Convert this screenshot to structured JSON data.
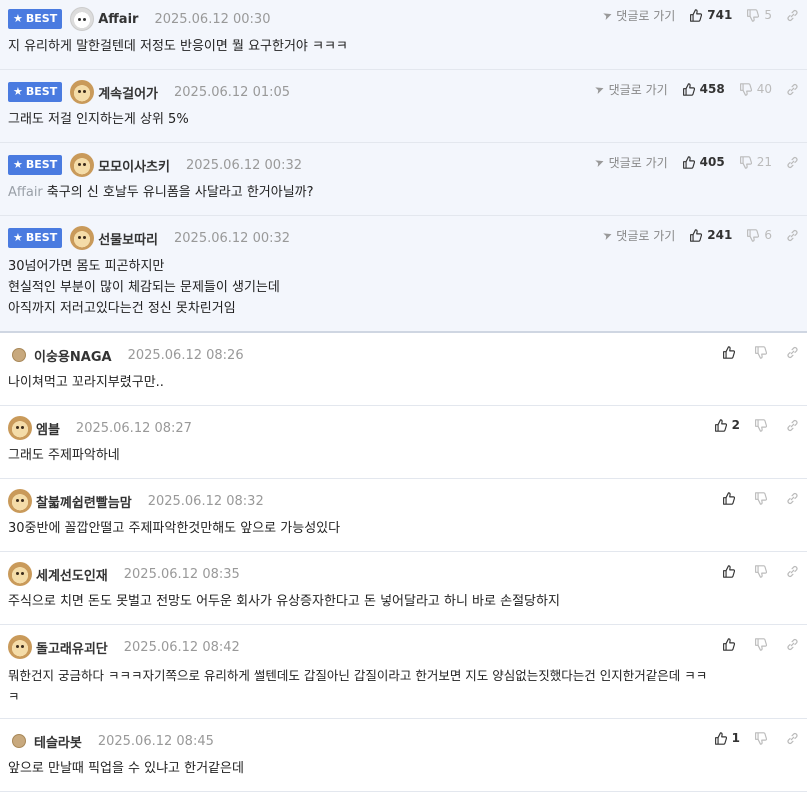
{
  "best_label": "BEST",
  "goto_label": "댓글로 가기",
  "comments": [
    {
      "author": "Affair",
      "date": "2025.06.12 00:30",
      "up": "741",
      "down": "5",
      "lines": [
        "지 유리하게 말한걸텐데 저정도 반응이면 뭘 요구한거야 ㅋㅋㅋ"
      ]
    },
    {
      "author": "계속걸어가",
      "date": "2025.06.12 01:05",
      "up": "458",
      "down": "40",
      "lines": [
        "그래도 저걸 인지하는게 상위 5%"
      ]
    },
    {
      "author": "모모이사츠키",
      "date": "2025.06.12 00:32",
      "up": "405",
      "down": "21",
      "reply_to": "Affair",
      "lines": [
        "축구의 신 호날두 유니폼을 사달라고 한거아닐까?"
      ]
    },
    {
      "author": "선물보따리",
      "date": "2025.06.12 00:32",
      "up": "241",
      "down": "6",
      "lines": [
        "30넘어가면 몸도 피곤하지만",
        "현실적인 부분이 많이 체감되는 문제들이 생기는데",
        "아직까지 저러고있다는건 정신 못차린거임"
      ]
    },
    {
      "author": "이숭용NAGA",
      "date": "2025.06.12 08:26",
      "up": "",
      "down": "",
      "lines": [
        "나이쳐먹고 꼬라지부렸구만.."
      ]
    },
    {
      "author": "엠블",
      "date": "2025.06.12 08:27",
      "up": "2",
      "down": "",
      "lines": [
        "그래도 주제파악하네"
      ]
    },
    {
      "author": "찰붋꼐쉽련빨늠맘",
      "date": "2025.06.12 08:32",
      "up": "",
      "down": "",
      "lines": [
        "30중반에 꼴깝안떨고 주제파악한것만해도 앞으로 가능성있다"
      ]
    },
    {
      "author": "세계선도인재",
      "date": "2025.06.12 08:35",
      "up": "",
      "down": "",
      "lines": [
        "주식으로 치면 돈도 못벌고 전망도 어두운 회사가 유상증자한다고 돈 넣어달라고 하니 바로 손절당하지"
      ]
    },
    {
      "author": "돌고래유괴단",
      "date": "2025.06.12 08:42",
      "up": "",
      "down": "",
      "lines": [
        "뭐한건지 궁금하다 ㅋㅋㅋ자기쪽으로 유리하게 썰텐데도 갑질아닌 갑질이라고 한거보면 지도 양심없는짓했다는건 인지한거같은데 ㅋㅋ",
        "ㅋ"
      ]
    },
    {
      "author": "테슬라봇",
      "date": "2025.06.12 08:45",
      "up": "1",
      "down": "",
      "lines": [
        "앞으로 만날때 픽업을 수 있냐고 한거같은데"
      ]
    }
  ]
}
